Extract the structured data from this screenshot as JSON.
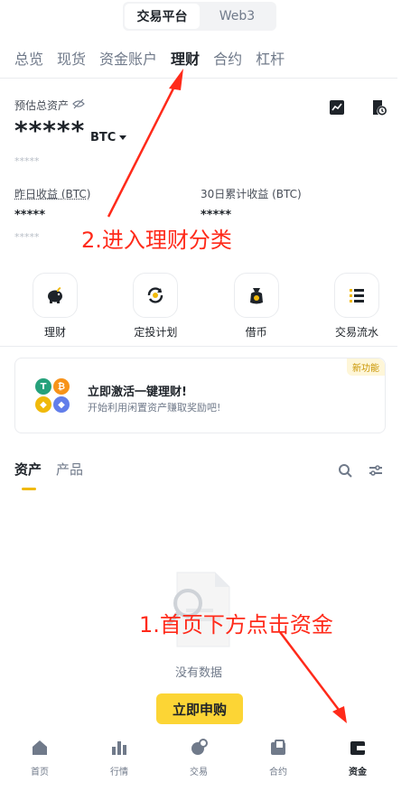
{
  "top_switch": {
    "exchange": "交易平台",
    "web3": "Web3"
  },
  "tabs": [
    "总览",
    "现货",
    "资金账户",
    "理财",
    "合约",
    "杠杆"
  ],
  "account": {
    "estimated_label": "预估总资产",
    "total_hidden": "*****",
    "unit": "BTC",
    "sub_hidden": "*****",
    "yesterday_label": "昨日收益 (BTC)",
    "yesterday_value": "*****",
    "yesterday_sub": "*****",
    "cum30_label": "30日累计收益 (BTC)",
    "cum30_value": "*****"
  },
  "quick_actions": [
    {
      "label": "理财",
      "icon": "piggy-bank-icon"
    },
    {
      "label": "定投计划",
      "icon": "recurring-icon"
    },
    {
      "label": "借币",
      "icon": "loan-bag-icon"
    },
    {
      "label": "交易流水",
      "icon": "list-icon"
    }
  ],
  "banner": {
    "badge": "新功能",
    "title": "立即激活一键理财!",
    "subtitle": "开始利用闲置资产赚取奖励吧!"
  },
  "asset_tabs": [
    "资产",
    "产品"
  ],
  "empty": {
    "text": "没有数据",
    "button": "立即申购"
  },
  "bottom_nav": [
    {
      "label": "首页",
      "icon": "home-icon"
    },
    {
      "label": "行情",
      "icon": "markets-icon"
    },
    {
      "label": "交易",
      "icon": "trade-icon"
    },
    {
      "label": "合约",
      "icon": "futures-icon"
    },
    {
      "label": "资金",
      "icon": "wallet-icon"
    }
  ],
  "annotations": {
    "step1": "1.首页下方点击资金",
    "step2": "2.进入理财分类"
  },
  "colors": {
    "accent": "#fcd535",
    "annotation": "#ff2a1a",
    "text": "#1e2329",
    "muted": "#707a8a"
  }
}
